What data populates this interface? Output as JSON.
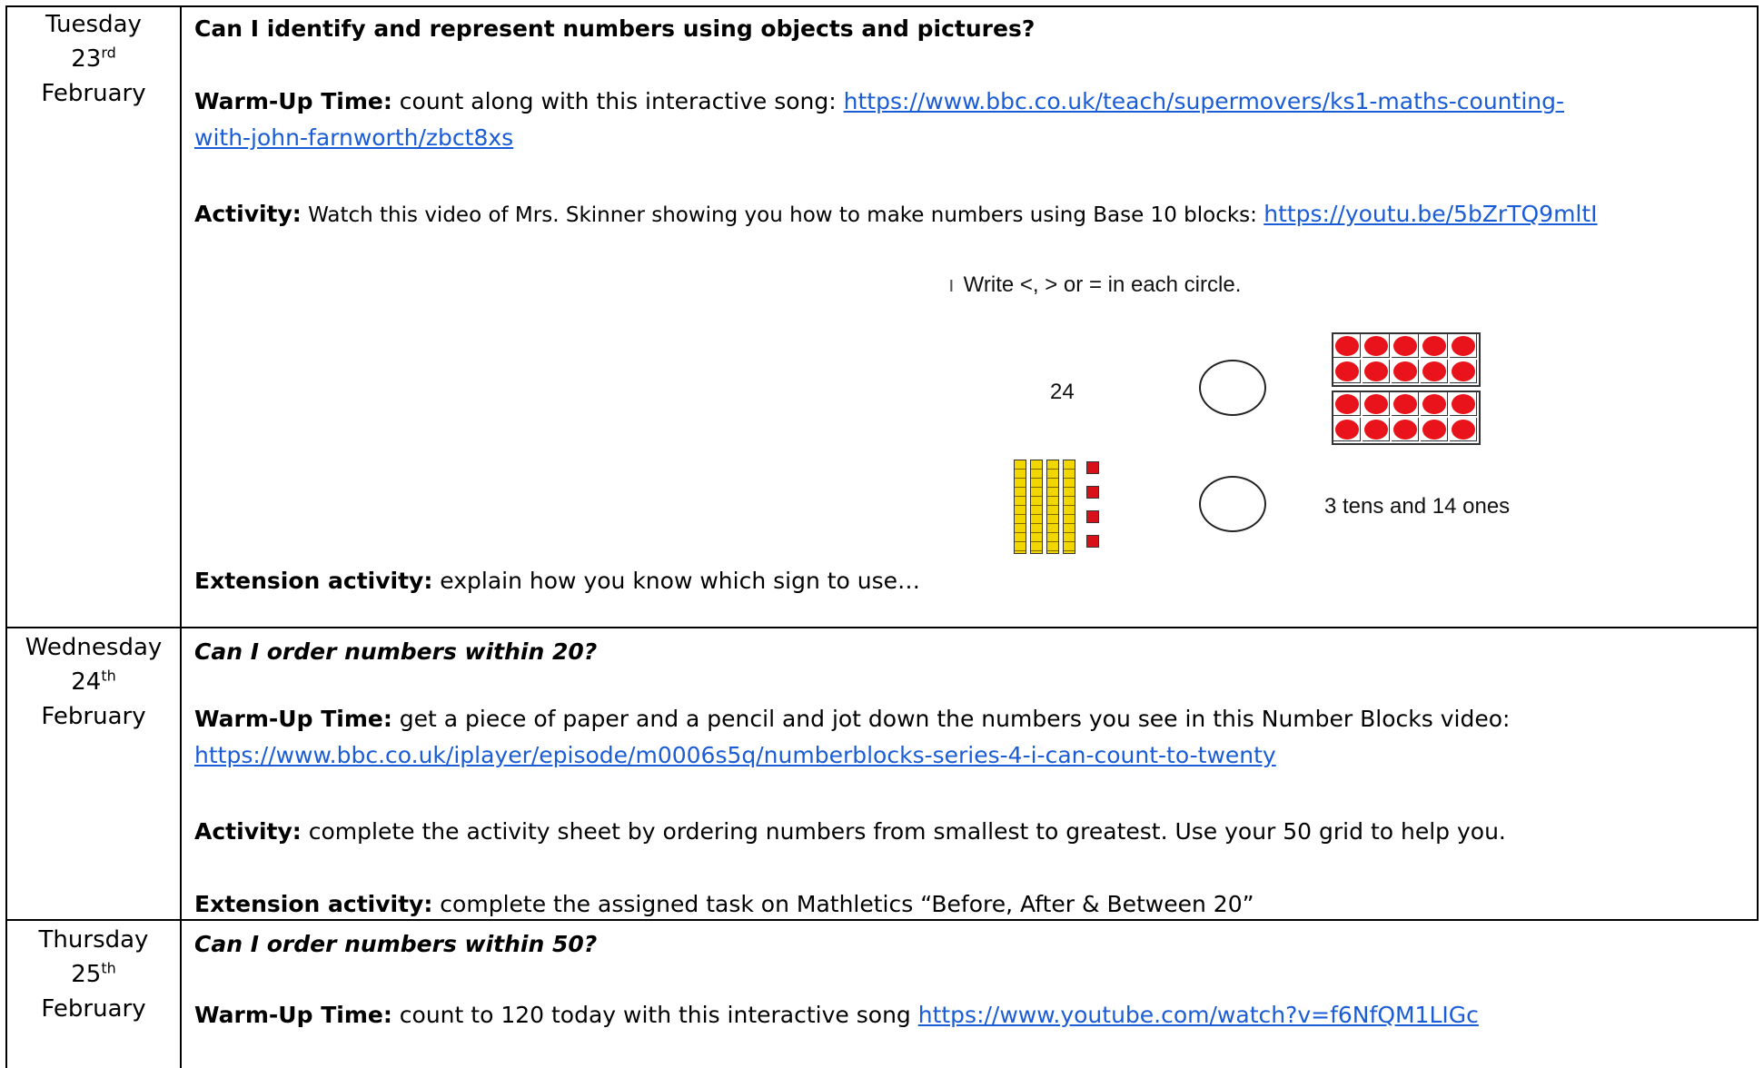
{
  "rows": [
    {
      "day": "Tuesday",
      "date_num": "23",
      "date_suffix": "rd",
      "month": "February",
      "question": "Can I identify and represent numbers using objects and pictures?",
      "warmup_label": "Warm-Up Time:",
      "warmup_text": " count along with this interactive song: ",
      "warmup_link_part1": "https://www.bbc.co.uk/teach/supermovers/ks1-maths-counting-",
      "warmup_link_part2": "with-john-farnworth/zbct8xs",
      "activity_label": "Activity:",
      "activity_text": " Watch this video of Mrs. Skinner showing you how to make numbers using Base 10 blocks: ",
      "activity_link": "https://youtu.be/5bZrTQ9mltI",
      "extension_label": "Extension activity:",
      "extension_text": "  explain how you know which sign to use…"
    },
    {
      "day": "Wednesday",
      "date_num": "24",
      "date_suffix": "th",
      "month": "February",
      "question": "Can I order numbers within 20?",
      "warmup_label": "Warm-Up Time:",
      "warmup_text": " get a piece of paper and a pencil and jot down the numbers you see in this Number Blocks video:",
      "warmup_link": "https://www.bbc.co.uk/iplayer/episode/m0006s5q/numberblocks-series-4-i-can-count-to-twenty",
      "activity_label": "Activity:",
      "activity_text": " complete the activity sheet by ordering numbers from smallest to greatest. Use your 50 grid to help you.",
      "extension_label": "Extension activity:",
      "extension_text": "  complete the assigned task on Mathletics “Before, After & Between 20”"
    },
    {
      "day": "Thursday",
      "date_num": "25",
      "date_suffix": "th",
      "month": "February",
      "question": "Can I order numbers within 50?",
      "warmup_label": "Warm-Up Time:",
      "warmup_text": "  count to 120 today with this interactive song ",
      "warmup_link": "https://www.youtube.com/watch?v=f6NfQM1LIGc"
    }
  ],
  "worksheet": {
    "instruction": "Write <, > or = in each circle.",
    "number": "24",
    "phrase": "3 tens and 14 ones",
    "ten_frame_counters": 20,
    "base10_tens": 4,
    "base10_ones": 4,
    "colors": {
      "counter": "#e8131b",
      "rod": "#f2d600",
      "cube": "#d8101a"
    }
  }
}
